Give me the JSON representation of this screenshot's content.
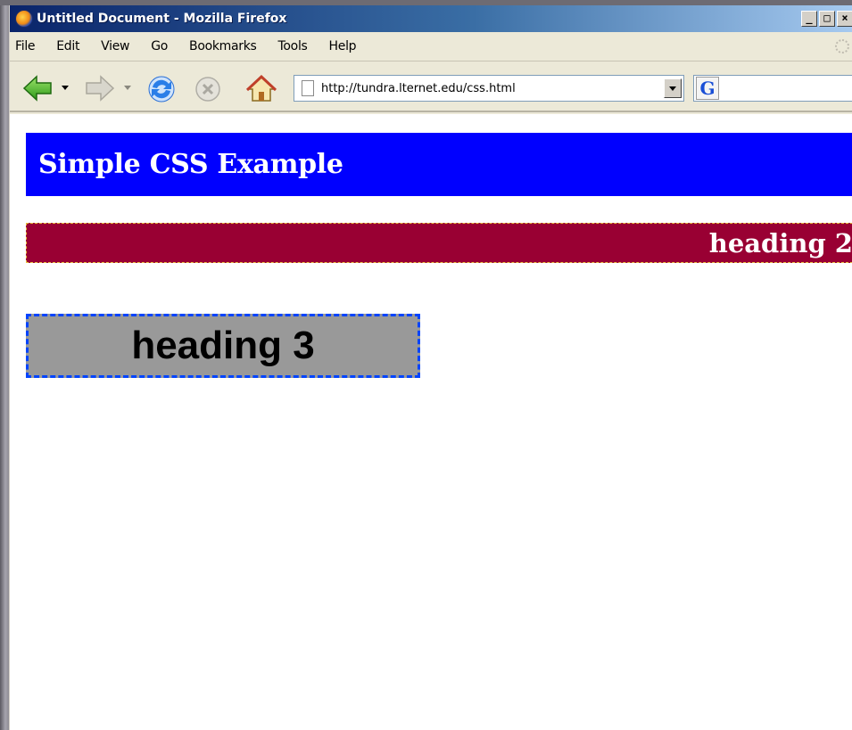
{
  "window": {
    "title": "Untitled Document - Mozilla Firefox",
    "buttons": [
      "_",
      "□",
      "×"
    ]
  },
  "menubar": {
    "items": [
      {
        "label": "File"
      },
      {
        "label": "Edit"
      },
      {
        "label": "View"
      },
      {
        "label": "Go"
      },
      {
        "label": "Bookmarks"
      },
      {
        "label": "Tools"
      },
      {
        "label": "Help"
      }
    ]
  },
  "navbar": {
    "url": "http://tundra.lternet.edu/css.html",
    "search_engine_glyph": "G",
    "icons": [
      "back-icon",
      "forward-icon",
      "reload-icon",
      "stop-icon",
      "home-icon"
    ]
  },
  "content": {
    "heading1": "Simple CSS Example",
    "heading2": "heading 2",
    "heading3": "heading 3"
  },
  "colors": {
    "heading1_bg": "#0000ff",
    "heading2_bg": "#990033",
    "heading2_border": "#e8c040",
    "heading3_bg": "#999999",
    "heading3_border": "#0044ff"
  }
}
